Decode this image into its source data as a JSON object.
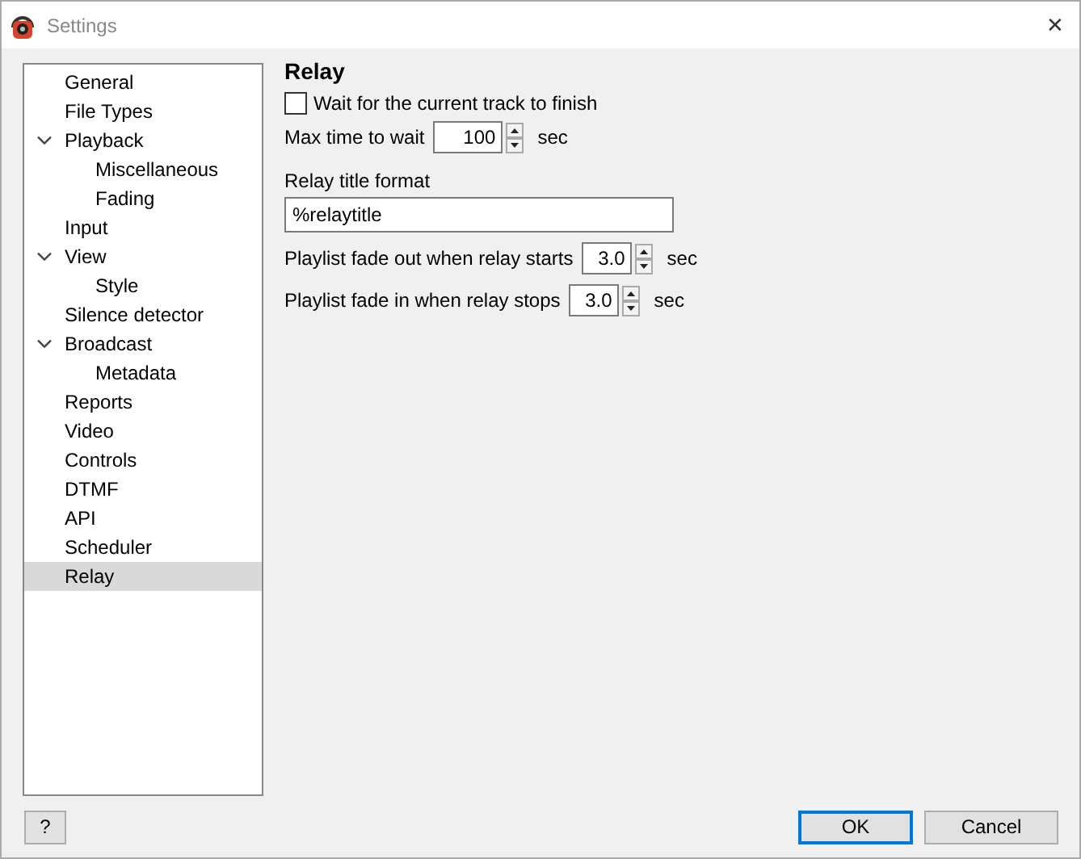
{
  "window": {
    "title": "Settings",
    "close": "✕"
  },
  "tree": [
    {
      "label": "General",
      "selected": false
    },
    {
      "label": "File Types",
      "selected": false
    },
    {
      "label": "Playback",
      "selected": false,
      "expanded": true,
      "children": [
        {
          "label": "Miscellaneous",
          "selected": false
        },
        {
          "label": "Fading",
          "selected": false
        }
      ]
    },
    {
      "label": "Input",
      "selected": false
    },
    {
      "label": "View",
      "selected": false,
      "expanded": true,
      "children": [
        {
          "label": "Style",
          "selected": false
        }
      ]
    },
    {
      "label": "Silence detector",
      "selected": false
    },
    {
      "label": "Broadcast",
      "selected": false,
      "expanded": true,
      "children": [
        {
          "label": "Metadata",
          "selected": false
        }
      ]
    },
    {
      "label": "Reports",
      "selected": false
    },
    {
      "label": "Video",
      "selected": false
    },
    {
      "label": "Controls",
      "selected": false
    },
    {
      "label": "DTMF",
      "selected": false
    },
    {
      "label": "API",
      "selected": false
    },
    {
      "label": "Scheduler",
      "selected": false
    },
    {
      "label": "Relay",
      "selected": true
    }
  ],
  "page": {
    "title": "Relay",
    "wait_checkbox": {
      "label": "Wait for the current track to finish",
      "checked": false
    },
    "max_wait": {
      "label": "Max time to wait",
      "value": "100",
      "unit": "sec"
    },
    "title_format": {
      "label": "Relay title format",
      "value": "%relaytitle"
    },
    "fade_out": {
      "label": "Playlist fade out when relay starts",
      "value": "3.0",
      "unit": "sec"
    },
    "fade_in": {
      "label": "Playlist fade in when relay stops",
      "value": "3.0",
      "unit": "sec"
    }
  },
  "buttons": {
    "help": "?",
    "ok": "OK",
    "cancel": "Cancel"
  }
}
